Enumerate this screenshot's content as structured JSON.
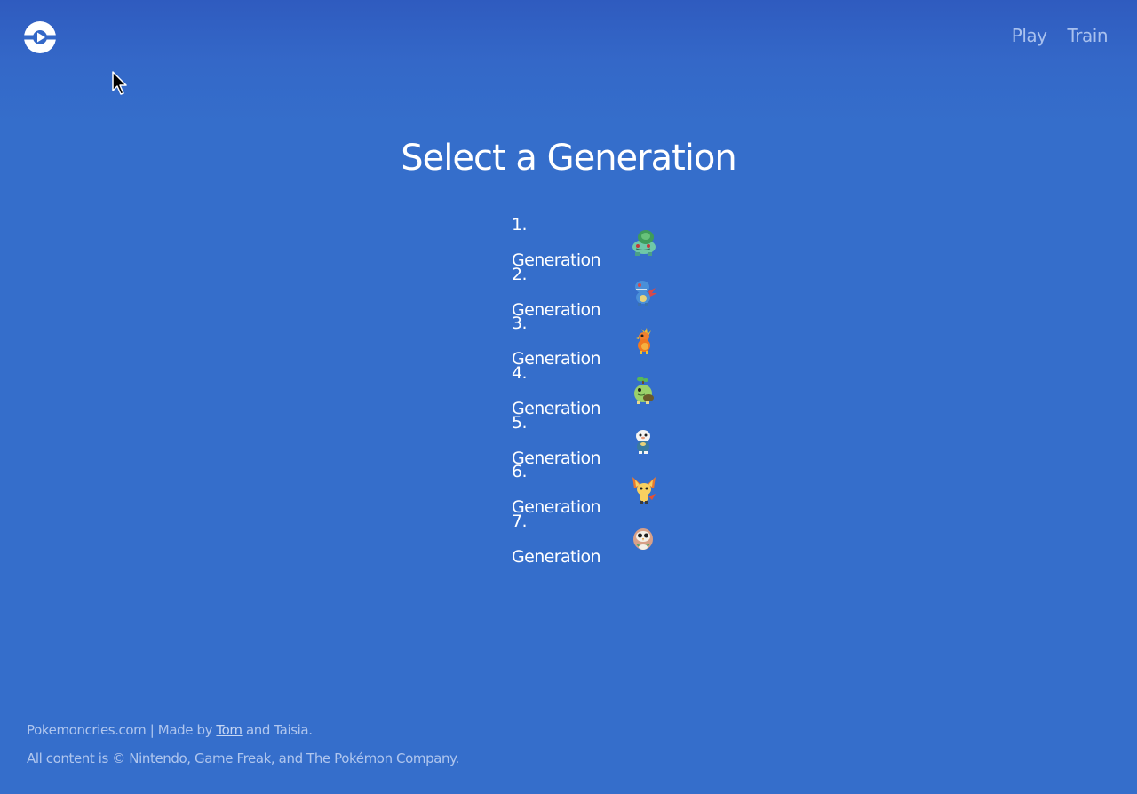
{
  "header": {
    "logo_icon": "logo-play-ring-icon",
    "nav": [
      {
        "label": "Play"
      },
      {
        "label": "Train"
      }
    ]
  },
  "main": {
    "title": "Select a Generation",
    "generations": [
      {
        "label": "1. Generation",
        "sprite": "bulbasaur-sprite-icon"
      },
      {
        "label": "2. Generation",
        "sprite": "totodile-sprite-icon"
      },
      {
        "label": "3. Generation",
        "sprite": "torchic-sprite-icon"
      },
      {
        "label": "4. Generation",
        "sprite": "turtwig-sprite-icon"
      },
      {
        "label": "5. Generation",
        "sprite": "oshawott-sprite-icon"
      },
      {
        "label": "6. Generation",
        "sprite": "fennekin-sprite-icon"
      },
      {
        "label": "7. Generation",
        "sprite": "rowlet-sprite-icon"
      }
    ]
  },
  "footer": {
    "site_name": "Pokemoncries.com",
    "separator": " | Made by ",
    "author_link": "Tom",
    "and_text": " and Taisia.",
    "copyright": "All content is © Nintendo, Game Freak, and The Pokémon Company."
  },
  "colors": {
    "background": "#356ecb",
    "nav_text": "#a9c1ee",
    "footer_text": "#b0c6ee"
  }
}
